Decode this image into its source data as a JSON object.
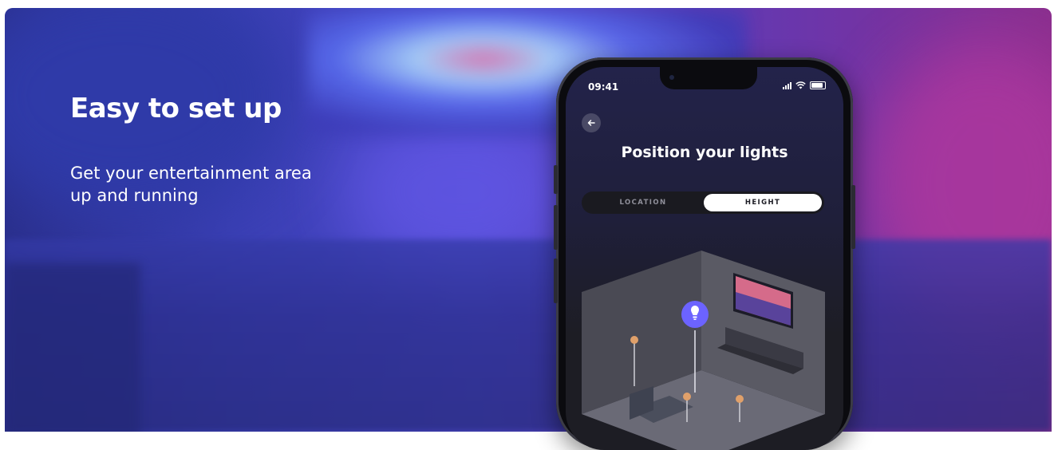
{
  "banner": {
    "headline": "Easy to set up",
    "subline": "Get your entertainment area up and running"
  },
  "phone": {
    "status_time": "09:41",
    "page_title": "Position your lights",
    "tabs": [
      {
        "label": "LOCATION",
        "selected": false
      },
      {
        "label": "HEIGHT",
        "selected": true
      }
    ],
    "icons": {
      "back": "arrow-left-icon",
      "signal": "cellular-signal-icon",
      "wifi": "wifi-icon",
      "battery": "battery-icon",
      "light": "lightbulb-icon"
    }
  },
  "colors": {
    "accent_light_marker": "#6c63ff",
    "tab_selected_bg": "#ffffff",
    "lamp_orange": "#e0a06a"
  }
}
